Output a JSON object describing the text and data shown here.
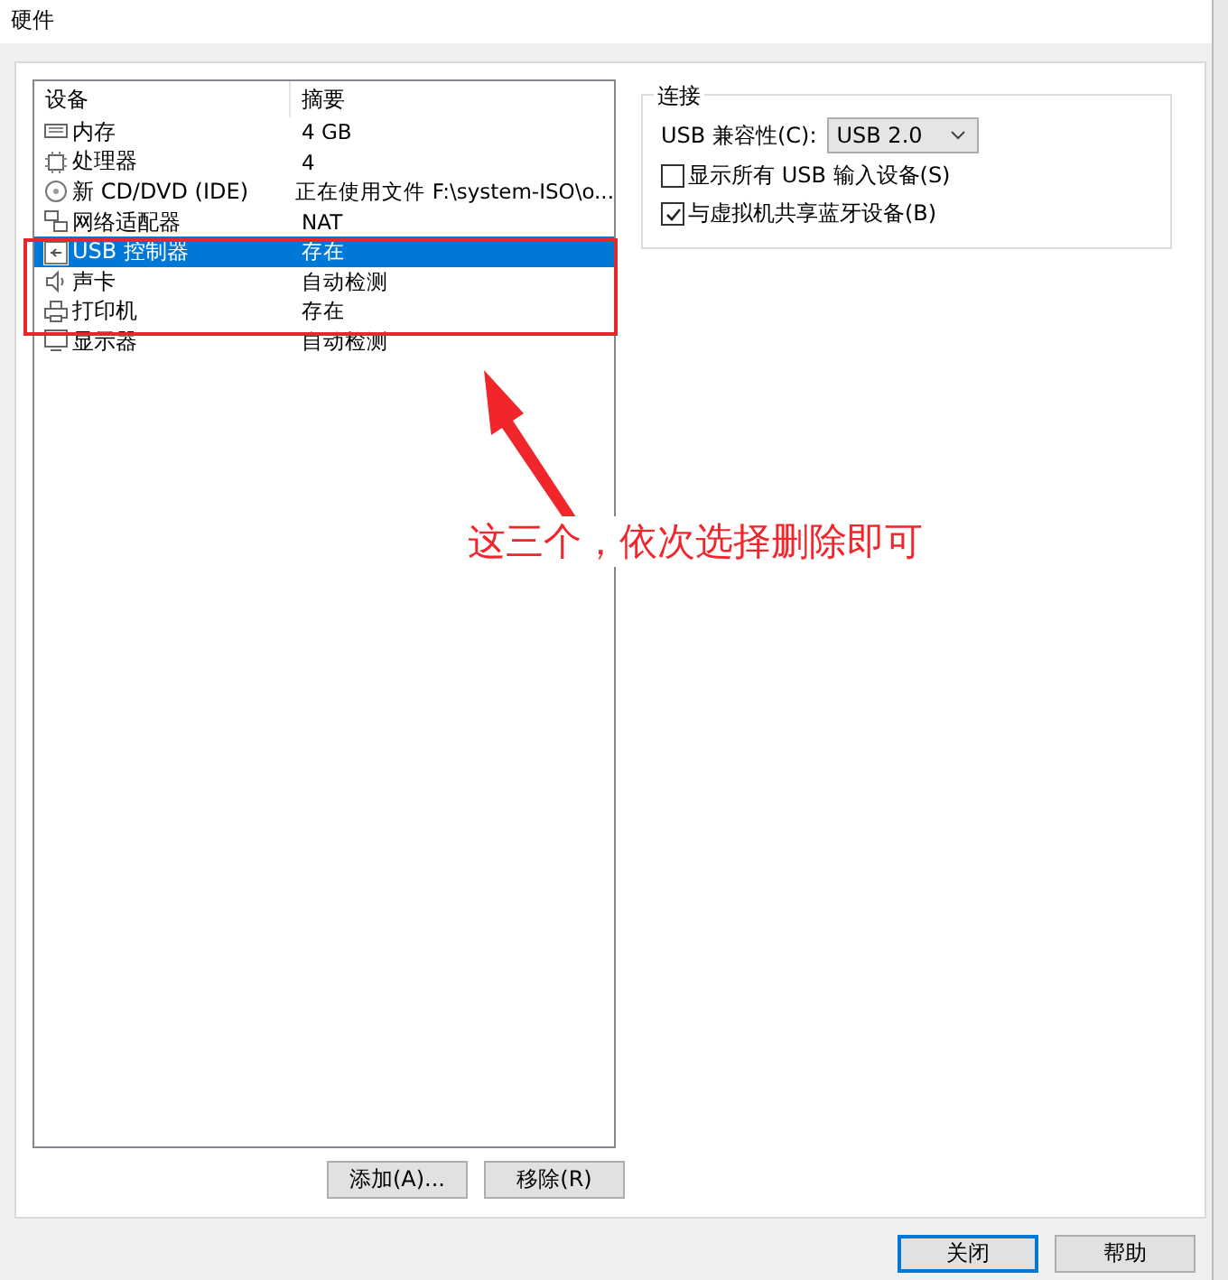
{
  "window": {
    "title": "硬件"
  },
  "device_list": {
    "columns": [
      "设备",
      "摘要"
    ],
    "rows": [
      {
        "kind": "memory",
        "name": "内存",
        "summary": "4 GB",
        "selected": false
      },
      {
        "kind": "cpu",
        "name": "处理器",
        "summary": "4",
        "selected": false
      },
      {
        "kind": "disc",
        "name": "新 CD/DVD (IDE)",
        "summary": "正在使用文件 F:\\system-ISO\\o...",
        "selected": false
      },
      {
        "kind": "network",
        "name": "网络适配器",
        "summary": "NAT",
        "selected": false
      },
      {
        "kind": "usb",
        "name": "USB 控制器",
        "summary": "存在",
        "selected": true
      },
      {
        "kind": "sound",
        "name": "声卡",
        "summary": "自动检测",
        "selected": false
      },
      {
        "kind": "printer",
        "name": "打印机",
        "summary": "存在",
        "selected": false
      },
      {
        "kind": "display",
        "name": "显示器",
        "summary": "自动检测",
        "selected": false
      }
    ]
  },
  "list_buttons": [
    "添加(A)...",
    "移除(R)"
  ],
  "connection": {
    "title": "连接",
    "compat_label": "USB 兼容性(C):",
    "compat_value": "USB 2.0",
    "options": [
      {
        "label": "显示所有 USB 输入设备(S)",
        "checked": false
      },
      {
        "label": "与虚拟机共享蓝牙设备(B)",
        "checked": true
      }
    ]
  },
  "annotation": {
    "text": "这三个，依次选择删除即可"
  },
  "dialog_buttons": [
    {
      "label": "关闭",
      "default": true
    },
    {
      "label": "帮助",
      "default": false
    }
  ]
}
